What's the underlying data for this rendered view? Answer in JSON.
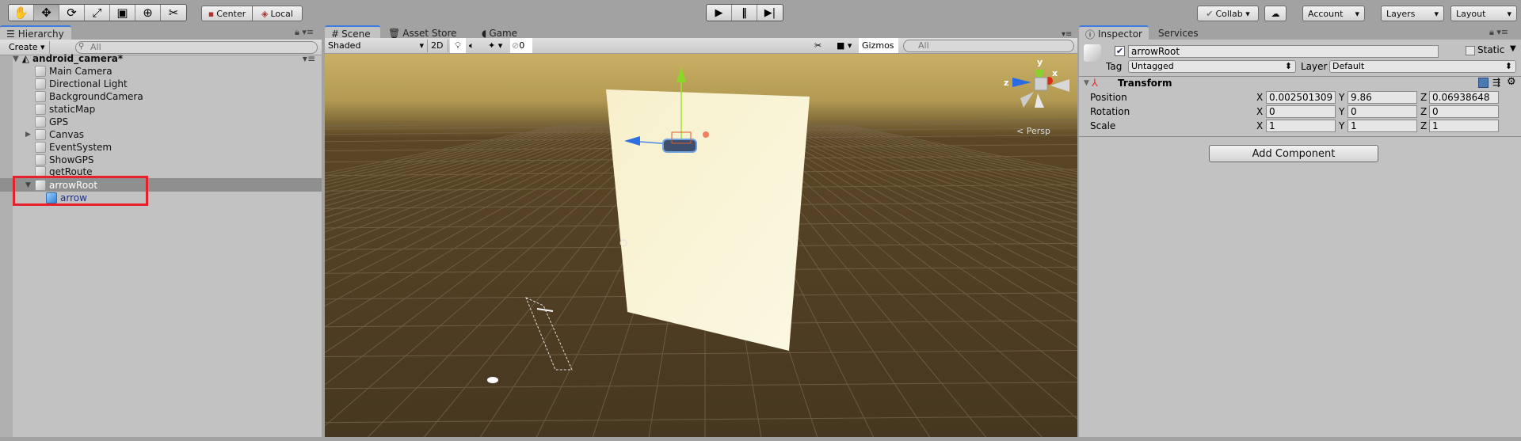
{
  "toolbar": {
    "tools": [
      "hand-tool",
      "move-tool",
      "rotate-tool",
      "scale-tool",
      "rect-tool",
      "transform-tool",
      "custom-tool"
    ],
    "active_tool": "move-tool",
    "pivot": "Center",
    "space": "Local",
    "collab": "Collab",
    "account": "Account",
    "layers": "Layers",
    "layout": "Layout"
  },
  "hierarchy": {
    "tab": "Hierarchy",
    "create": "Create",
    "search_placeholder": "All",
    "scene": "android_camera*",
    "items": [
      "Main Camera",
      "Directional Light",
      "BackgroundCamera",
      "staticMap",
      "GPS",
      "Canvas",
      "EventSystem",
      "ShowGPS",
      "getRoute",
      "arrowRoot",
      "arrow"
    ],
    "selected": "arrowRoot",
    "highlight_color": "#e8202a"
  },
  "scene_panel": {
    "tabs": [
      "Scene",
      "Asset Store",
      "Game"
    ],
    "active_tab": "Scene",
    "shading": "Shaded",
    "mode_2d": "2D",
    "fx_count": "0",
    "gizmos": "Gizmos",
    "search_placeholder": "All",
    "projection": "Persp",
    "axes": {
      "x": "x",
      "y": "y",
      "z": "z"
    }
  },
  "inspector": {
    "tabs": [
      "Inspector",
      "Services"
    ],
    "object_name": "arrowRoot",
    "active": true,
    "static_label": "Static",
    "tag_label": "Tag",
    "tag": "Untagged",
    "layer_label": "Layer",
    "layer": "Default",
    "component": "Transform",
    "rows": [
      {
        "label": "Position",
        "x": "0.002501309",
        "y": "9.86",
        "z": "0.06938648"
      },
      {
        "label": "Rotation",
        "x": "0",
        "y": "0",
        "z": "0"
      },
      {
        "label": "Scale",
        "x": "1",
        "y": "1",
        "z": "1"
      }
    ],
    "axis_labels": [
      "X",
      "Y",
      "Z"
    ],
    "add_component": "Add Component"
  }
}
